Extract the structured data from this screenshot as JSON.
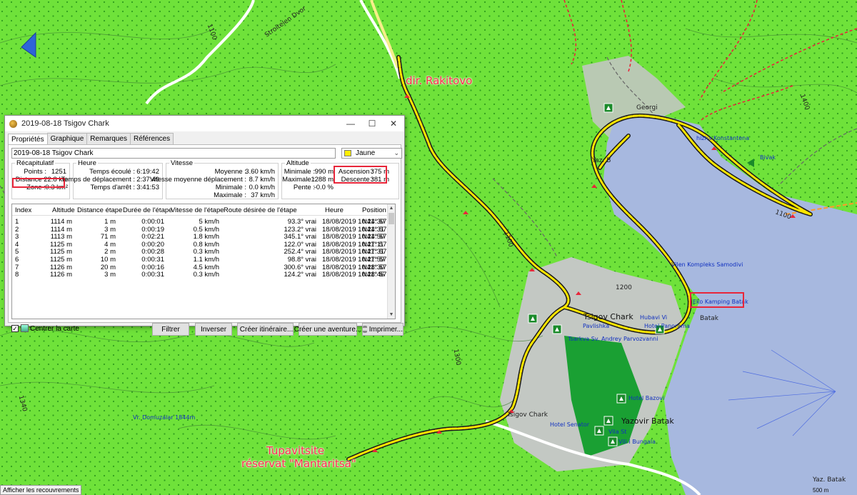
{
  "map": {
    "labels": {
      "rakitovo": "dir. Rakitovo",
      "tupavitsite": "Tupavitsite",
      "mantaritsa": "réservat \"Mantaritsa\"",
      "tsigov_chark_main": "Tsigov Chark",
      "tsigov_chark_south": "Tsigov Chark",
      "yazovir_batak": "Yazovir Batak",
      "batak": "Batak",
      "eko_kamping": "Eko Kamping Batak",
      "hubavi_vi": "Hubavi Vi",
      "hotel_panorama": "Hotel Panorama",
      "vil_kompleks": "Vilen Kompleks Samodivi",
      "bivak": "Bivak",
      "hizha_konstantena": "hizha Konstantena",
      "georgi": "Georgi",
      "yaz_batak": "Yaz. Batak",
      "yaz_b": "Yaz. B",
      "cherkva": "Tsarkva Sv. Andrey Parvozvanni",
      "pavlishka": "Pavlishka",
      "hotel_senator": "Hotel Senator",
      "villa_st": "Vila St",
      "vili_bungala": "Vili i Bungala",
      "hotel_bazov": "Hotel Bazovi",
      "domuzalar": "Vr. Domuzalar 1844m",
      "stroitelen": "Stroitelen Dvor",
      "elev_1100_a": "1100",
      "elev_1100_b": "1100",
      "elev_1100_c": "1100",
      "elev_1200": "1200",
      "elev_1300": "1300",
      "elev_1400": "1400",
      "elev_1340": "1340"
    },
    "colors": {
      "forest": "#6fe23a",
      "lake": "#a7b8df",
      "track": "#ffe600",
      "highlight": "#e8263a"
    },
    "bottom_label": "Afficher les recouvrements",
    "scale": "500 m"
  },
  "dialog": {
    "title": "2019-08-18 Tsigov Chark",
    "window_buttons": [
      "—",
      "☐",
      "✕"
    ],
    "tabs": [
      "Propriétés",
      "Graphique",
      "Remarques",
      "Références"
    ],
    "name_value": "2019-08-18 Tsigov Chark",
    "color_value": "Jaune",
    "recap": {
      "legend": "Récapitulatif",
      "rows": [
        {
          "k": "Points :",
          "v": "1251"
        },
        {
          "k": "Distance :",
          "v": "22.8 km"
        },
        {
          "k": "Zone :",
          "v": "0.3 km²"
        }
      ]
    },
    "heure": {
      "legend": "Heure",
      "rows": [
        {
          "k": "Temps écoulé :",
          "v": "6:19:42"
        },
        {
          "k": "Temps de déplacement :",
          "v": "2:37:49"
        },
        {
          "k": "Temps d'arrêt :",
          "v": "3:41:53"
        }
      ]
    },
    "vitesse": {
      "legend": "Vitesse",
      "rows": [
        {
          "k": "Moyenne :",
          "v": "3.60 km/h"
        },
        {
          "k": "Vitesse moyenne déplacement :",
          "v": "8.7 km/h"
        },
        {
          "k": "Minimale :",
          "v": "0.0 km/h"
        },
        {
          "k": "Maximale :",
          "v": "37 km/h"
        }
      ]
    },
    "altitude": {
      "legend": "Altitude",
      "left": [
        {
          "k": "Minimale :",
          "v": "990 m"
        },
        {
          "k": "Maximale :",
          "v": "1288 m"
        },
        {
          "k": "Pente :",
          "v": "-0.0 %"
        }
      ],
      "right": [
        {
          "k": "Ascension :",
          "v": "375 m"
        },
        {
          "k": "Descente :",
          "v": "381 m"
        }
      ]
    },
    "table": {
      "headers": [
        "Index",
        "Altitude",
        "Distance étape",
        "Durée de l'étape",
        "Vitesse de l'étape",
        "Route désirée de l'étape",
        "Heure",
        "Position"
      ],
      "rows": [
        [
          "1",
          "1114 m",
          "1 m",
          "0:00:01",
          "5 km/h",
          "93.3° vrai",
          "18/08/2019 10:24:30",
          "N41° 57..."
        ],
        [
          "2",
          "1114 m",
          "3 m",
          "0:00:19",
          "0.5 km/h",
          "123.2° vrai",
          "18/08/2019 10:24:31",
          "N41° 57..."
        ],
        [
          "3",
          "1113 m",
          "71 m",
          "0:02:21",
          "1.8 km/h",
          "345.1° vrai",
          "18/08/2019 10:24:50",
          "N41° 57..."
        ],
        [
          "4",
          "1125 m",
          "4 m",
          "0:00:20",
          "0.8 km/h",
          "122.0° vrai",
          "18/08/2019 10:27:11",
          "N41° 57..."
        ],
        [
          "5",
          "1125 m",
          "2 m",
          "0:00:28",
          "0.3 km/h",
          "252.4° vrai",
          "18/08/2019 10:27:31",
          "N41° 57..."
        ],
        [
          "6",
          "1125 m",
          "10 m",
          "0:00:31",
          "1.1 km/h",
          "98.8° vrai",
          "18/08/2019 10:27:59",
          "N41° 57..."
        ],
        [
          "7",
          "1126 m",
          "20 m",
          "0:00:16",
          "4.5 km/h",
          "300.6° vrai",
          "18/08/2019 10:28:30",
          "N41° 57..."
        ],
        [
          "8",
          "1126 m",
          "3 m",
          "0:00:31",
          "0.3 km/h",
          "124.2° vrai",
          "18/08/2019 10:28:46",
          "N41° 57..."
        ]
      ]
    },
    "center_map_label": "Centrer la carte",
    "buttons": {
      "filter": "Filtrer",
      "invert": "Inverser",
      "create_route": "Créer itinéraire...",
      "create_adventure": "Créer une aventure...",
      "print": "Imprimer..."
    }
  }
}
